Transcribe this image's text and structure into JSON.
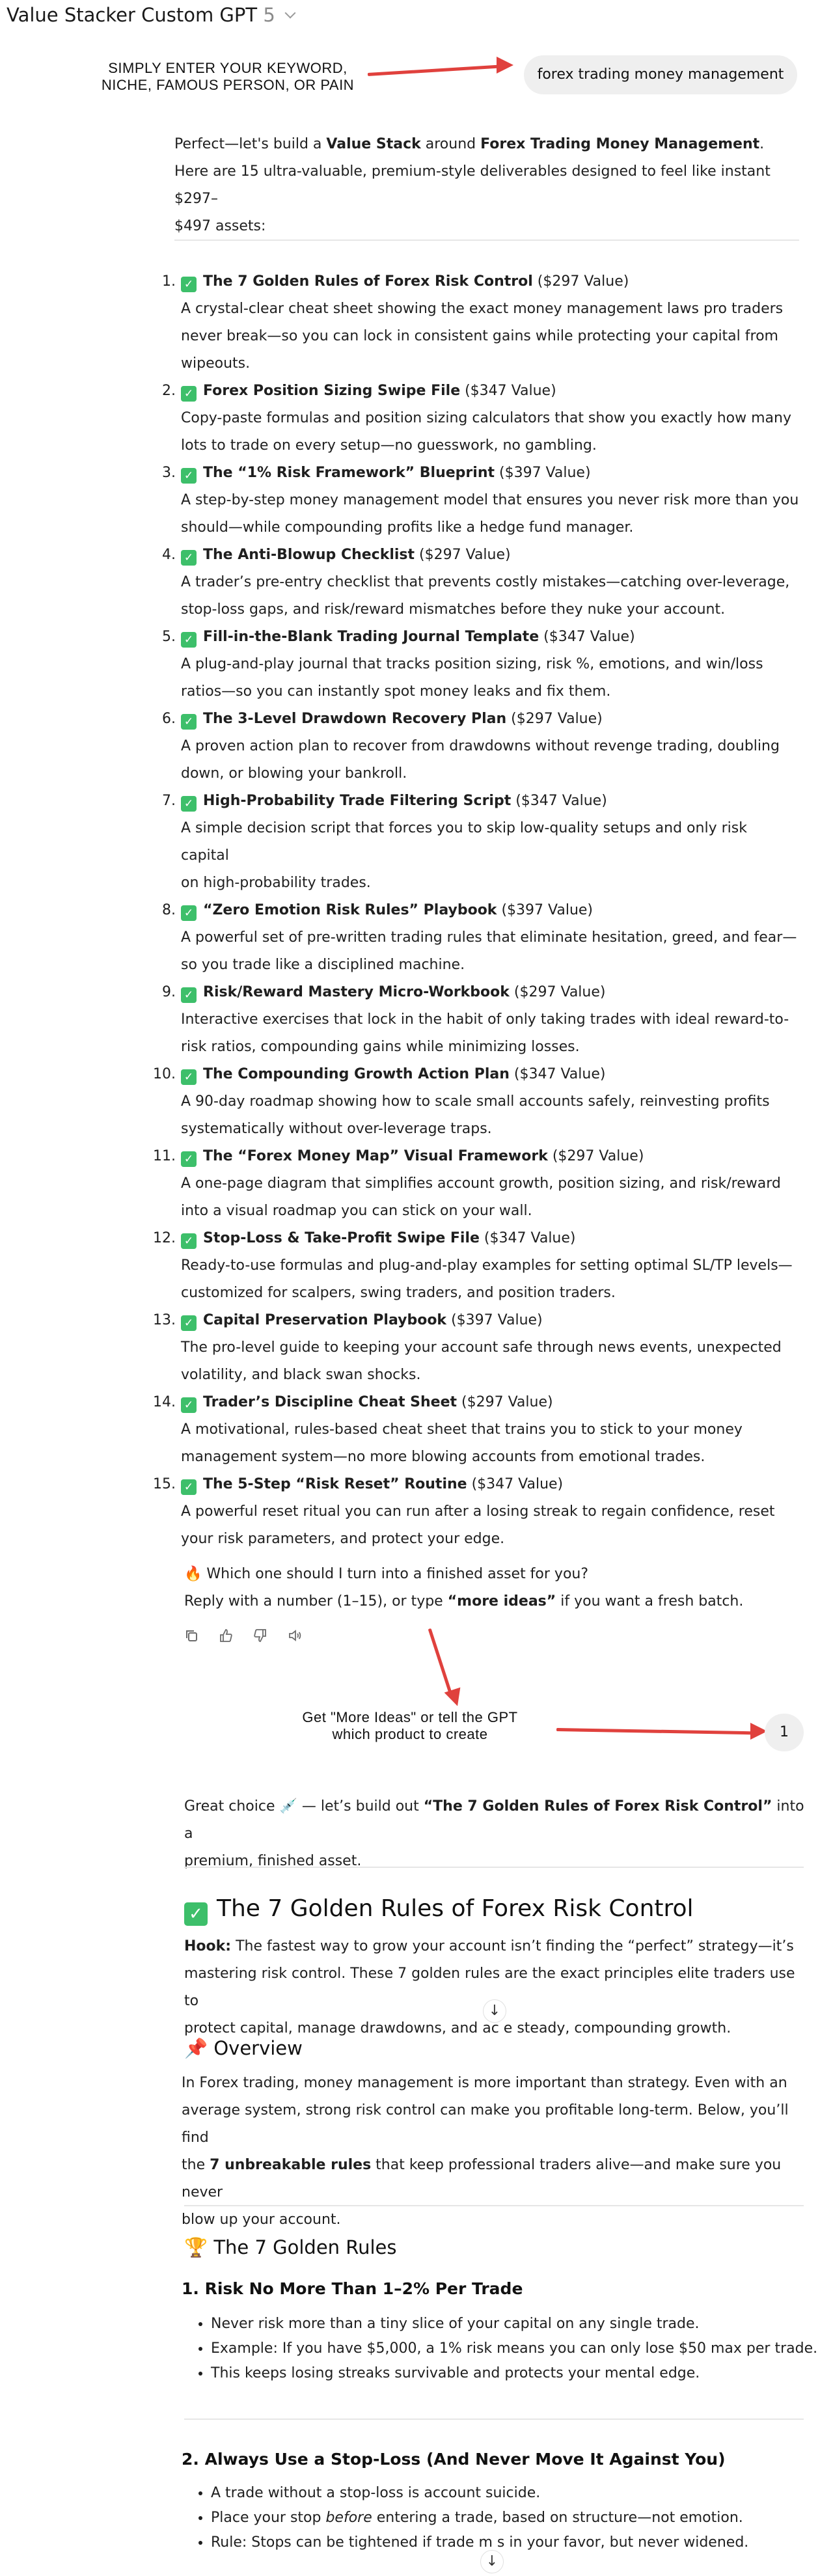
{
  "header": {
    "title": "Value Stacker Custom GPT",
    "version": "5"
  },
  "annotation1": {
    "line1": "SIMPLY ENTER YOUR KEYWORD,",
    "line2": "NICHE, FAMOUS PERSON, OR PAIN"
  },
  "user_message1": "forex trading money management",
  "intro": {
    "p1_a": "Perfect—let's build a ",
    "p1_b": "Value Stack",
    "p1_c": " around ",
    "p1_d": "Forex Trading Money Management",
    "p1_e": ".",
    "p2": "Here are 15 ultra-valuable, premium-style deliverables designed to feel like instant $297–",
    "p3": "$497 assets:"
  },
  "items": [
    {
      "num": "1.",
      "title": "The 7 Golden Rules of Forex Risk Control",
      "value": " ($297 Value)",
      "desc": [
        "A crystal-clear cheat sheet showing the exact money management laws pro traders",
        "never break—so you can lock in consistent gains while protecting your capital from",
        "wipeouts."
      ]
    },
    {
      "num": "2.",
      "title": "Forex Position Sizing Swipe File",
      "value": " ($347 Value)",
      "desc": [
        "Copy-paste formulas and position sizing calculators that show you exactly how many",
        "lots to trade on every setup—no guesswork, no gambling."
      ]
    },
    {
      "num": "3.",
      "title": "The “1% Risk Framework” Blueprint",
      "value": " ($397 Value)",
      "desc": [
        "A step-by-step money management model that ensures you never risk more than you",
        "should—while compounding profits like a hedge fund manager."
      ]
    },
    {
      "num": "4.",
      "title": "The Anti-Blowup Checklist",
      "value": " ($297 Value)",
      "desc": [
        "A trader’s pre-entry checklist that prevents costly mistakes—catching over-leverage,",
        "stop-loss gaps, and risk/reward mismatches before they nuke your account."
      ]
    },
    {
      "num": "5.",
      "title": "Fill-in-the-Blank Trading Journal Template",
      "value": " ($347 Value)",
      "desc": [
        "A plug-and-play journal that tracks position sizing, risk %, emotions, and win/loss",
        "ratios—so you can instantly spot money leaks and fix them."
      ]
    },
    {
      "num": "6.",
      "title": "The 3-Level Drawdown Recovery Plan",
      "value": " ($297 Value)",
      "desc": [
        "A proven action plan to recover from drawdowns without revenge trading, doubling",
        "down, or blowing your bankroll."
      ]
    },
    {
      "num": "7.",
      "title": "High-Probability Trade Filtering Script",
      "value": " ($347 Value)",
      "desc": [
        "A simple decision script that forces you to skip low-quality setups and only risk capital",
        "on high-probability trades."
      ]
    },
    {
      "num": "8.",
      "title": "“Zero Emotion Risk Rules” Playbook",
      "value": " ($397 Value)",
      "desc": [
        "A powerful set of pre-written trading rules that eliminate hesitation, greed, and fear—",
        "so you trade like a disciplined machine."
      ]
    },
    {
      "num": "9.",
      "title": "Risk/Reward Mastery Micro-Workbook",
      "value": " ($297 Value)",
      "desc": [
        "Interactive exercises that lock in the habit of only taking trades with ideal reward-to-",
        "risk ratios, compounding gains while minimizing losses."
      ]
    },
    {
      "num": "10.",
      "title": "The Compounding Growth Action Plan",
      "value": " ($347 Value)",
      "desc": [
        "A 90-day roadmap showing how to scale small accounts safely, reinvesting profits",
        "systematically without over-leverage traps."
      ]
    },
    {
      "num": "11.",
      "title": "The “Forex Money Map” Visual Framework",
      "value": " ($297 Value)",
      "desc": [
        "A one-page diagram that simplifies account growth, position sizing, and risk/reward",
        "into a visual roadmap you can stick on your wall."
      ]
    },
    {
      "num": "12.",
      "title": "Stop-Loss & Take-Profit Swipe File",
      "value": " ($347 Value)",
      "desc": [
        "Ready-to-use formulas and plug-and-play examples for setting optimal SL/TP levels—",
        "customized for scalpers, swing traders, and position traders."
      ]
    },
    {
      "num": "13.",
      "title": "Capital Preservation Playbook",
      "value": " ($397 Value)",
      "desc": [
        "The pro-level guide to keeping your account safe through news events, unexpected",
        "volatility, and black swan shocks."
      ]
    },
    {
      "num": "14.",
      "title": "Trader’s Discipline Cheat Sheet",
      "value": " ($297 Value)",
      "desc": [
        "A motivational, rules-based cheat sheet that trains you to stick to your money",
        "management system—no more blowing accounts from emotional trades."
      ]
    },
    {
      "num": "15.",
      "title": "The 5-Step “Risk Reset” Routine",
      "value": " ($347 Value)",
      "desc": [
        "A powerful reset ritual you can run after a losing streak to regain confidence, reset",
        "your risk parameters, and protect your edge."
      ]
    }
  ],
  "followup": {
    "line1": "Which one should I turn into a finished asset for you?",
    "line2_a": "Reply with a number (1–15), or type ",
    "line2_b": "“more ideas”",
    "line2_c": " if you want a fresh batch."
  },
  "annotation2": {
    "line1": "Get \"More Ideas\" or tell the GPT",
    "line2": "which product to create"
  },
  "user_message2": "1",
  "choice": {
    "a": "Great choice ",
    "b": " — let’s build out ",
    "c": "“The 7 Golden Rules of Forex Risk Control”",
    "d": " into a",
    "line2": "premium, finished asset."
  },
  "asset": {
    "title": "The 7 Golden Rules of Forex Risk Control",
    "hook_label": "Hook:",
    "hook_l1": " The fastest way to grow your account isn’t finding the “perfect” strategy—it’s",
    "hook_l2": "mastering risk control. These 7 golden rules are the exact principles elite traders use to",
    "hook_l3": "protect capital, manage drawdowns, and ac    e steady, compounding growth.",
    "overview_title": "Overview",
    "ov_l1": "In Forex trading, money management is more important than strategy. Even with an",
    "ov_l2": "average system, strong risk control can make you profitable long-term. Below, you’ll find",
    "ov_l3_a": "the ",
    "ov_l3_b": "7 unbreakable rules",
    "ov_l3_c": " that keep professional traders alive—and make sure you never",
    "ov_l4": "blow up your account.",
    "rules_title": "The 7 Golden Rules",
    "rule1_title": "1. Risk No More Than 1–2% Per Trade",
    "rule1_bullets": [
      "Never risk more than a tiny slice of your capital on any single trade.",
      "Example: If you have $5,000, a 1% risk means you can only lose $50 max per trade.",
      "This keeps losing streaks survivable and protects your mental edge."
    ],
    "rule2_title": "2. Always Use a Stop-Loss (And Never Move It Against You)",
    "rule2_b1": "A trade without a stop-loss is account suicide.",
    "rule2_b2_a": "Place your stop ",
    "rule2_b2_b": "before",
    "rule2_b2_c": " entering a trade, based on structure—not emotion.",
    "rule2_b3": "Rule: Stops can be tightened if trade m    s in your favor, but never widened."
  },
  "colors": {
    "accent_red": "#e0413d",
    "check_green": "#3dbf6a",
    "bubble": "#efefef"
  },
  "icons": [
    "copy-icon",
    "thumbs-up-icon",
    "thumbs-down-icon",
    "speaker-icon"
  ]
}
